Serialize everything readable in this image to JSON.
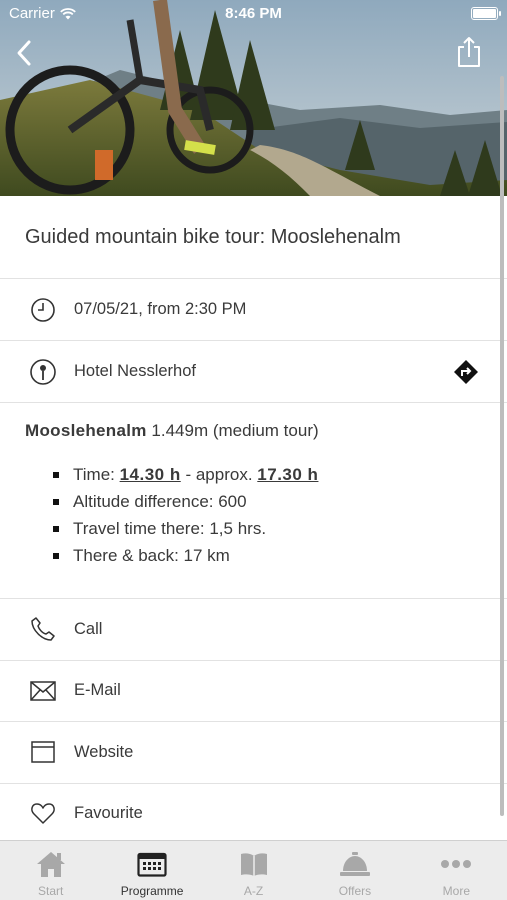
{
  "status_bar": {
    "carrier": "Carrier",
    "time": "8:46 PM"
  },
  "event": {
    "title": "Guided mountain bike tour: Mooslehenalm",
    "datetime": "07/05/21, from 2:30 PM",
    "location": "Hotel Nesslerhof"
  },
  "description": {
    "lead_bold": "Mooslehenalm",
    "lead_rest": " 1.449m (medium tour)",
    "bullets": {
      "time_prefix": "Time: ",
      "time_start": "14.30 h",
      "time_mid": " - approx. ",
      "time_end": "17.30 h",
      "altitude": "Altitude difference: 600",
      "travel": "Travel time there: 1,5 hrs.",
      "distance": "There & back: 17 km"
    }
  },
  "actions": {
    "call": "Call",
    "email": "E-Mail",
    "website": "Website",
    "favourite": "Favourite"
  },
  "tabs": [
    {
      "label": "Start",
      "icon": "home-icon",
      "active": false
    },
    {
      "label": "Programme",
      "icon": "calendar-icon",
      "active": true
    },
    {
      "label": "A-Z",
      "icon": "book-icon",
      "active": false
    },
    {
      "label": "Offers",
      "icon": "service-bell-icon",
      "active": false
    },
    {
      "label": "More",
      "icon": "more-dots-icon",
      "active": false
    }
  ],
  "colors": {
    "divider": "#e2e2e2",
    "tabbar_bg": "#ececec",
    "text": "#3a3a3a",
    "tab_inactive": "#a8a8a8"
  }
}
